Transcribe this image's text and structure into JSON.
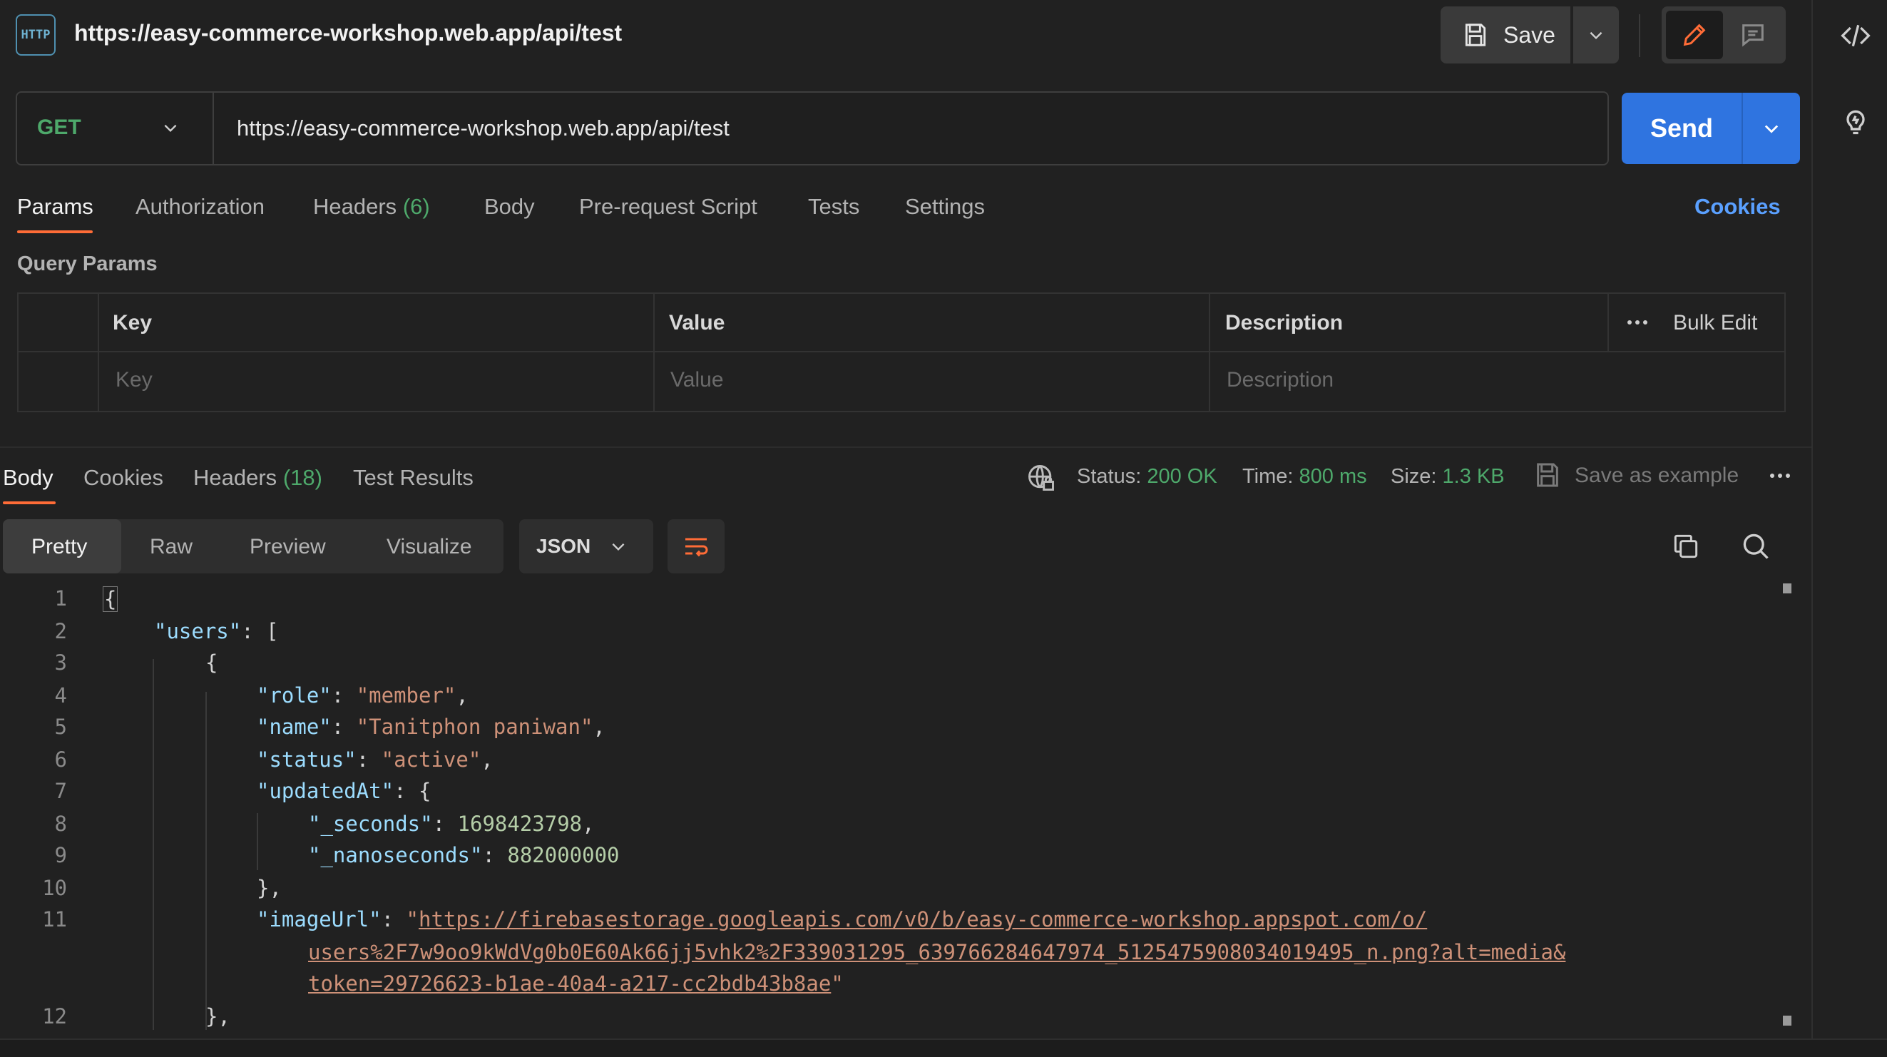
{
  "header": {
    "badge": "HTTP",
    "title": "https://easy-commerce-workshop.web.app/api/test",
    "save_label": "Save"
  },
  "request": {
    "method": "GET",
    "url": "https://easy-commerce-workshop.web.app/api/test",
    "send_label": "Send"
  },
  "request_tabs": {
    "params": "Params",
    "authorization": "Authorization",
    "headers": "Headers",
    "headers_count": "(6)",
    "body": "Body",
    "prerequest": "Pre-request Script",
    "tests": "Tests",
    "settings": "Settings",
    "cookies": "Cookies"
  },
  "query_params": {
    "label": "Query Params",
    "col_key": "Key",
    "col_value": "Value",
    "col_description": "Description",
    "bulk_edit": "Bulk Edit",
    "placeholder_key": "Key",
    "placeholder_value": "Value",
    "placeholder_description": "Description"
  },
  "response_tabs": {
    "body": "Body",
    "cookies": "Cookies",
    "headers": "Headers",
    "headers_count": "(18)",
    "test_results": "Test Results"
  },
  "response_status": {
    "status_label": "Status:",
    "status_value": "200 OK",
    "time_label": "Time:",
    "time_value": "800 ms",
    "size_label": "Size:",
    "size_value": "1.3 KB",
    "save_example": "Save as example"
  },
  "view_modes": {
    "pretty": "Pretty",
    "raw": "Raw",
    "preview": "Preview",
    "visualize": "Visualize",
    "format": "JSON"
  },
  "code": {
    "line_numbers": [
      "1",
      "2",
      "3",
      "4",
      "5",
      "6",
      "7",
      "8",
      "9",
      "10",
      "11",
      "12"
    ],
    "k_users": "\"users\"",
    "k_role": "\"role\"",
    "v_role": "\"member\"",
    "k_name": "\"name\"",
    "v_name": "\"Tanitphon paniwan\"",
    "k_status": "\"status\"",
    "v_status": "\"active\"",
    "k_updated": "\"updatedAt\"",
    "k_seconds": "\"_seconds\"",
    "v_seconds": "1698423798",
    "k_nanos": "\"_nanoseconds\"",
    "v_nanos": "882000000",
    "k_image": "\"imageUrl\"",
    "v_image_1": "https://firebasestorage.googleapis.com/v0/b/easy-commerce-workshop.appspot.com/o/",
    "v_image_2": "users%2F7w9oo9kWdVg0b0E60Ak66jj5vhk2%2F339031295_639766284647974_5125475908034019495_n.png?alt=media&",
    "v_image_3": "token=29726623-b1ae-40a4-a217-cc2bdb43b8ae"
  },
  "colors": {
    "accent": "#ff6c37",
    "send": "#2f74e0",
    "success": "#4ea96b",
    "link": "#5aa0ff"
  }
}
